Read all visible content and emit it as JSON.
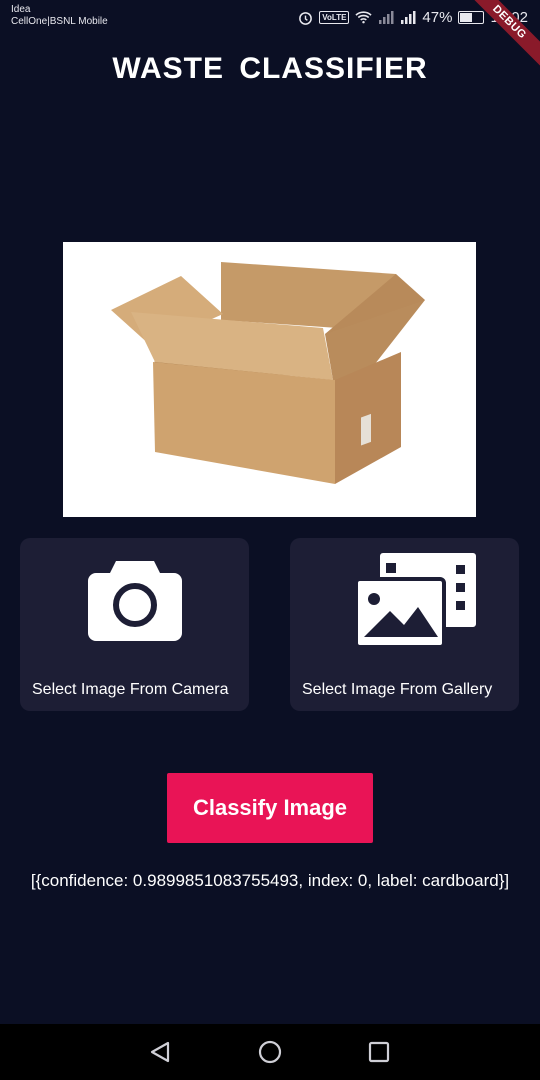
{
  "status_bar": {
    "carrier_1": "Idea",
    "carrier_2": "CellOne|BSNL Mobile",
    "volte": "VoLTE",
    "battery_percent": "47%",
    "time": "18:02",
    "debug_banner": "DEBUG"
  },
  "app": {
    "title": "WASTE  CLASSIFIER"
  },
  "options": {
    "camera_label": "Select Image From Camera",
    "gallery_label": "Select Image From Gallery"
  },
  "classify_button": "Classify Image",
  "result_text": "[{confidence: 0.9899851083755493, index: 0, label: cardboard}]",
  "colors": {
    "background": "#0b0f24",
    "card": "#1d1e35",
    "accent": "#e91456"
  },
  "icons": {
    "camera": "camera-icon",
    "gallery": "gallery-icon",
    "nav_back": "back-triangle-icon",
    "nav_home": "home-circle-icon",
    "nav_recents": "recents-square-icon"
  }
}
